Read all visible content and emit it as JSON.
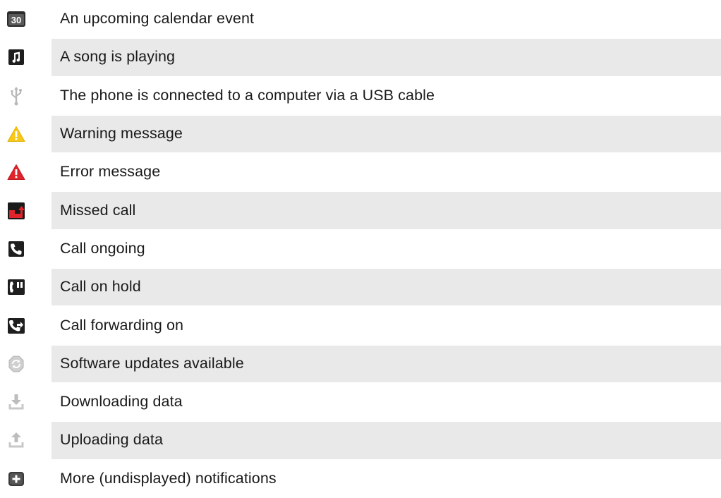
{
  "rows": [
    {
      "icon": "calendar-icon",
      "label": "An upcoming calendar event"
    },
    {
      "icon": "music-note-icon",
      "label": "A song is playing"
    },
    {
      "icon": "usb-icon",
      "label": "The phone is connected to a computer via a USB cable"
    },
    {
      "icon": "warning-icon",
      "label": "Warning message"
    },
    {
      "icon": "error-icon",
      "label": "Error message"
    },
    {
      "icon": "missed-call-icon",
      "label": "Missed call"
    },
    {
      "icon": "phone-icon",
      "label": "Call ongoing"
    },
    {
      "icon": "call-hold-icon",
      "label": "Call on hold"
    },
    {
      "icon": "call-forward-icon",
      "label": "Call forwarding on"
    },
    {
      "icon": "sync-icon",
      "label": "Software updates available"
    },
    {
      "icon": "download-icon",
      "label": "Downloading data"
    },
    {
      "icon": "upload-icon",
      "label": "Uploading data"
    },
    {
      "icon": "plus-icon",
      "label": "More (undisplayed) notifications"
    }
  ],
  "calendar_icon_text": "30",
  "colors": {
    "row_alt_bg": "#e9e9e9",
    "warning": "#f6c817",
    "error": "#e1242b",
    "missed_call": "#e1242b",
    "dark_icon": "#222222",
    "light_icon": "#bdbdbd"
  }
}
